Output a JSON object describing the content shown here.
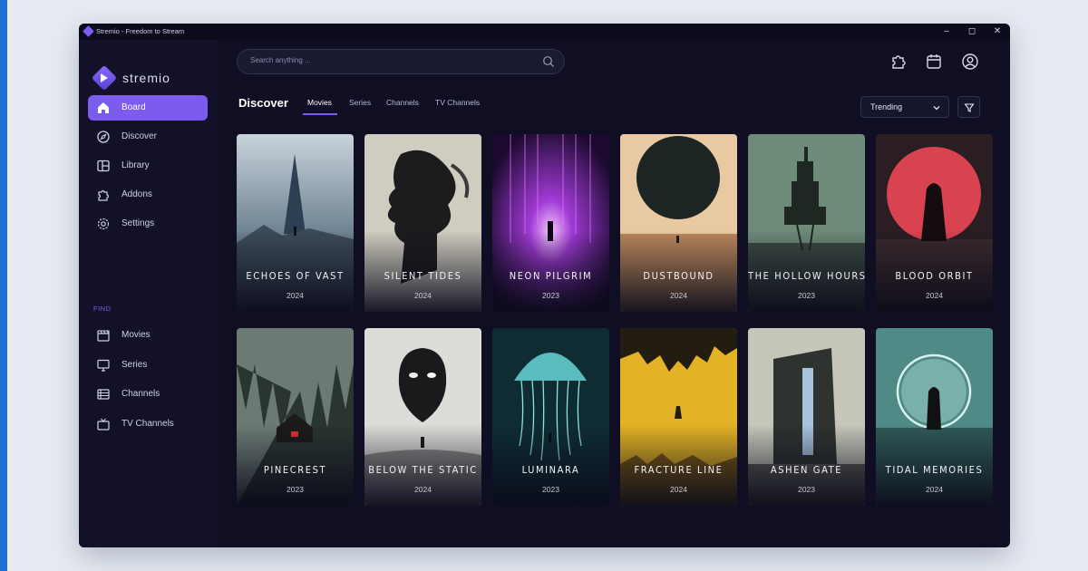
{
  "window": {
    "title": "Stremio - Freedom to Stream"
  },
  "brand": {
    "name": "stremio"
  },
  "sidebar": {
    "items": [
      {
        "label": "Board",
        "icon": "home-icon",
        "active": true
      },
      {
        "label": "Discover",
        "icon": "compass-icon"
      },
      {
        "label": "Library",
        "icon": "library-icon"
      },
      {
        "label": "Addons",
        "icon": "puzzle-icon"
      },
      {
        "label": "Settings",
        "icon": "gear-icon"
      }
    ],
    "find_label": "FIND",
    "find_items": [
      {
        "label": "Movies",
        "icon": "clapper-icon"
      },
      {
        "label": "Series",
        "icon": "monitor-icon"
      },
      {
        "label": "Channels",
        "icon": "channels-icon"
      },
      {
        "label": "TV Channels",
        "icon": "tv-icon"
      }
    ]
  },
  "search": {
    "placeholder": "Search anything ..."
  },
  "header_icons": [
    "puzzle-icon",
    "calendar-icon",
    "user-icon"
  ],
  "discover": {
    "title": "Discover",
    "tabs": [
      "Movies",
      "Series",
      "Channels",
      "TV Channels"
    ],
    "active_tab": "Movies",
    "sort": "Trending"
  },
  "colors": {
    "accent": "#7b5ced",
    "background": "#0f0e22",
    "sidebar": "#121129"
  },
  "movies": [
    {
      "title": "ECHOES OF VAST",
      "year": "2024"
    },
    {
      "title": "SILENT TIDES",
      "year": "2024"
    },
    {
      "title": "NEON PILGRIM",
      "year": "2023"
    },
    {
      "title": "DUSTBOUND",
      "year": "2024"
    },
    {
      "title": "THE HOLLOW HOURS",
      "year": "2023"
    },
    {
      "title": "BLOOD ORBIT",
      "year": "2024"
    },
    {
      "title": "PINECREST",
      "year": "2023"
    },
    {
      "title": "BELOW THE STATIC",
      "year": "2024"
    },
    {
      "title": "LUMINARA",
      "year": "2023"
    },
    {
      "title": "FRACTURE LINE",
      "year": "2024"
    },
    {
      "title": "ASHEN GATE",
      "year": "2023"
    },
    {
      "title": "TIDAL MEMORIES",
      "year": "2024"
    }
  ]
}
